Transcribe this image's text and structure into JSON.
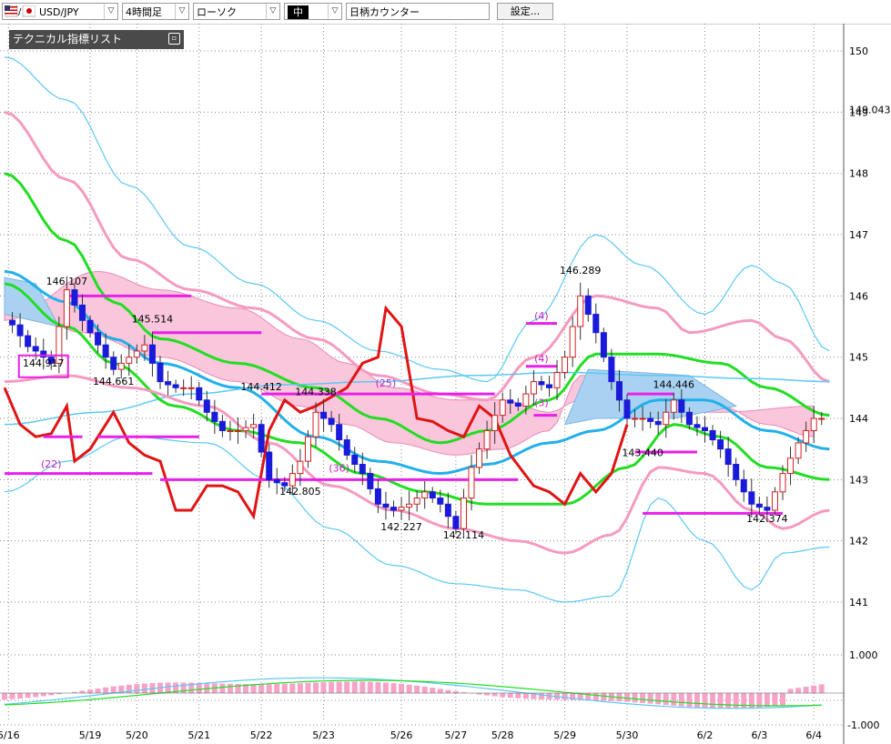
{
  "toolbar": {
    "symbol": "USD/JPY",
    "timeframe": "4時間足",
    "chart_style": "ローソク",
    "size": "中",
    "counter": "日柄カウンター",
    "settings_label": "設定..."
  },
  "indicator_panel": {
    "title": "テクニカル指標リスト"
  },
  "colors": {
    "candle_up": "#d42020",
    "candle_down": "#1a1adb",
    "cloud": "#f9c6dc",
    "cloud_blue": "#a9d2f2",
    "bollinger_outer": "#5bc8f5",
    "bollinger_2": "#f59ac0",
    "moving_avg": "#22dd22",
    "base_line": "#22b0e8",
    "lagging": "#e01414",
    "markers": "#e820e8"
  },
  "chart_data": {
    "type": "candlestick",
    "symbol": "USD/JPY",
    "y_ticks": [
      "150",
      "149",
      "148",
      "147",
      "146",
      "145",
      "144",
      "143",
      "142",
      "141"
    ],
    "ylim": [
      140.3,
      150.4
    ],
    "current_price": "149.043",
    "x_labels": [
      "5/16",
      "5/19",
      "5/20",
      "5/21",
      "5/22",
      "5/23",
      "5/26",
      "5/27",
      "5/28",
      "5/29",
      "5/30",
      "6/2",
      "6/3",
      "6/4"
    ],
    "x_label_bars": [
      0.5,
      11,
      17,
      25,
      33,
      41,
      51,
      58,
      64,
      72,
      80,
      90,
      97,
      104
    ],
    "bars": 106,
    "annotations": [
      {
        "text": "146.107",
        "bar": 8,
        "y": 146.18
      },
      {
        "text": "144.917",
        "bar": 5,
        "y": 144.85,
        "boxed": true
      },
      {
        "text": "145.514",
        "bar": 19,
        "y": 145.57
      },
      {
        "text": "144.661",
        "bar": 14,
        "y": 144.55
      },
      {
        "text": "144.412",
        "bar": 33,
        "y": 144.46
      },
      {
        "text": "144.338",
        "bar": 40,
        "y": 144.38
      },
      {
        "text": "142.805",
        "bar": 38,
        "y": 142.75
      },
      {
        "text": "142.227",
        "bar": 51,
        "y": 142.17
      },
      {
        "text": "142.114",
        "bar": 59,
        "y": 142.04
      },
      {
        "text": "146.289",
        "bar": 74,
        "y": 146.36
      },
      {
        "text": "144.446",
        "bar": 86,
        "y": 144.5
      },
      {
        "text": "143.440",
        "bar": 82,
        "y": 143.38
      },
      {
        "text": "142.374",
        "bar": 98,
        "y": 142.31
      },
      {
        "text": "(22)",
        "bar": 6,
        "y": 143.2
      },
      {
        "text": "(36)",
        "bar": 43,
        "y": 143.13
      },
      {
        "text": "(25)",
        "bar": 49,
        "y": 144.52
      },
      {
        "text": "(4)",
        "bar": 69,
        "y": 145.62
      },
      {
        "text": "(4)",
        "bar": 69,
        "y": 144.92
      },
      {
        "text": "(3)",
        "bar": 69,
        "y": 144.2
      }
    ],
    "osc_ticks": [
      "1.000",
      "-1.000"
    ]
  }
}
